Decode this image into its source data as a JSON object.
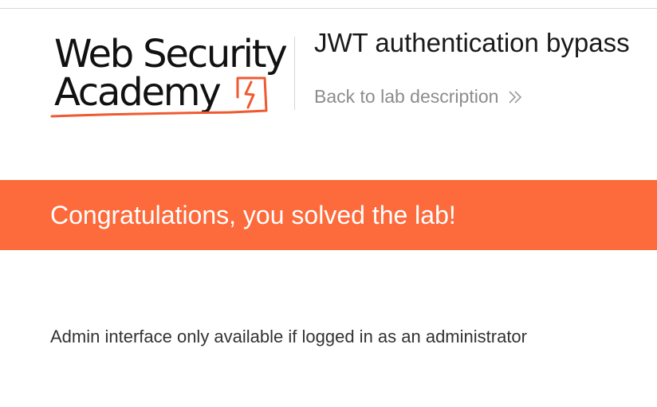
{
  "logo": {
    "line1": "Web Security",
    "line2": "Academy",
    "accent_color": "#ef5a30",
    "icon": "lightning-bolt-flask-icon"
  },
  "header": {
    "lab_title": "JWT authentication bypass",
    "back_link_label": "Back to lab description",
    "back_link_icon": "double-chevron-right-icon"
  },
  "banner": {
    "message": "Congratulations, you solved the lab!",
    "color": "#fd6a3b"
  },
  "main": {
    "message": "Admin interface only available if logged in as an administrator"
  }
}
